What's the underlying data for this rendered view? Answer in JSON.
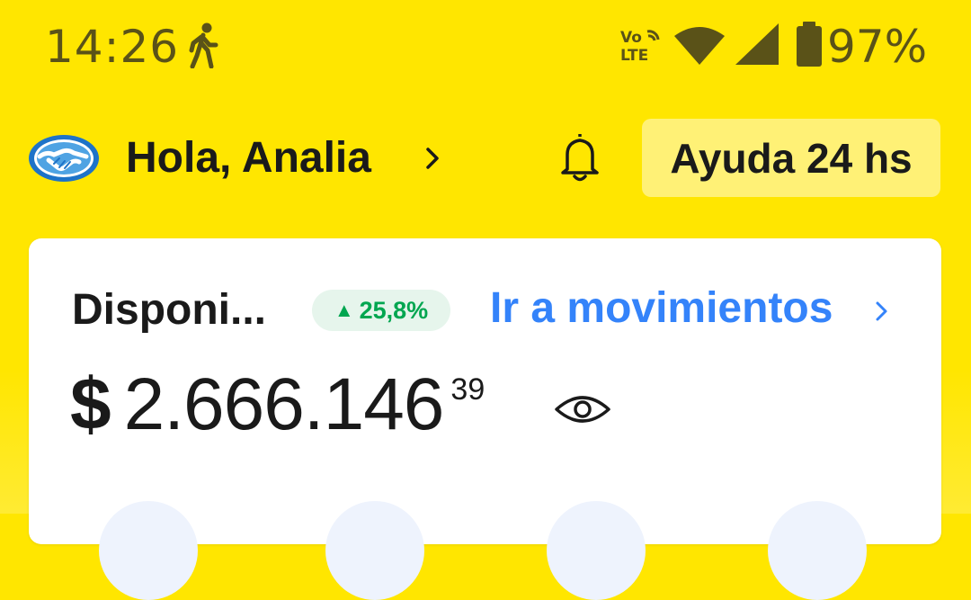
{
  "status_bar": {
    "time": "14:26",
    "icons": [
      "walking-icon",
      "volte-icon",
      "wifi-icon",
      "cell-signal-icon",
      "battery-icon"
    ],
    "volte_label": "Vo LTE",
    "battery_percent": "97%"
  },
  "header": {
    "greeting": "Hola, Analia",
    "help_button": "Ayuda 24 hs",
    "icons": [
      "mercado-pago-handshake-logo",
      "chevron-right-icon",
      "bell-icon"
    ]
  },
  "balance_card": {
    "label": "Disponi...",
    "growth": "25,8%",
    "movements_link": "Ir a movimientos",
    "currency_symbol": "$",
    "amount": "2.666.146",
    "cents": "39",
    "icons": [
      "eye-icon"
    ]
  },
  "colors": {
    "background": "#FFE600",
    "help_button_bg": "#FFF176",
    "link": "#3483FA",
    "positive": "#00A650",
    "positive_badge_bg": "#E6F5EC",
    "status_text": "#5A5218",
    "card_bg": "#FFFFFF",
    "shortcut_bg": "#EEF3FD"
  }
}
